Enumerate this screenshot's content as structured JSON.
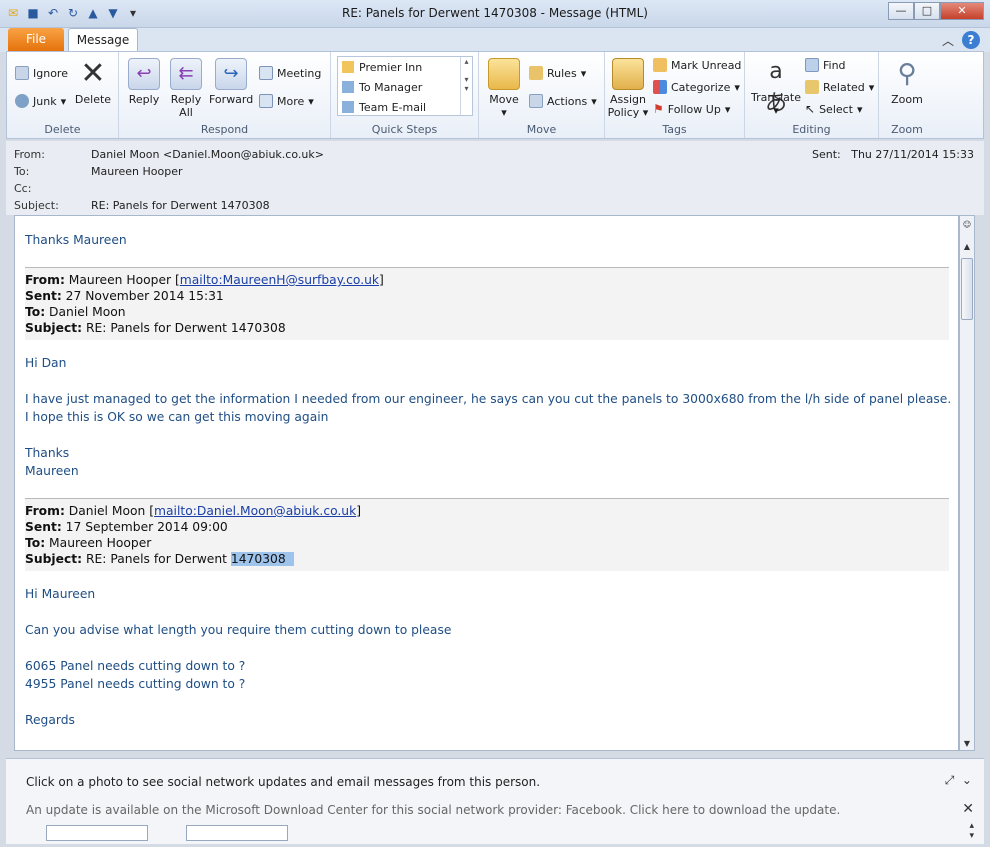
{
  "window": {
    "title": "RE: Panels for Derwent 1470308  -  Message (HTML)"
  },
  "tabs": {
    "file": "File",
    "message": "Message"
  },
  "ribbon": {
    "delete_group": {
      "label": "Delete",
      "ignore": "Ignore",
      "junk": "Junk",
      "delete": "Delete"
    },
    "respond_group": {
      "label": "Respond",
      "reply": "Reply",
      "reply_all_1": "Reply",
      "reply_all_2": "All",
      "forward": "Forward",
      "meeting": "Meeting",
      "more": "More"
    },
    "quicksteps_group": {
      "label": "Quick Steps",
      "items": [
        "Premier Inn",
        "To Manager",
        "Team E-mail"
      ]
    },
    "move_group": {
      "label": "Move",
      "move": "Move",
      "rules": "Rules",
      "actions": "Actions"
    },
    "tags_group": {
      "label": "Tags",
      "assign_1": "Assign",
      "assign_2": "Policy",
      "mark_unread": "Mark Unread",
      "categorize": "Categorize",
      "follow_up": "Follow Up"
    },
    "editing_group": {
      "label": "Editing",
      "translate": "Translate",
      "find": "Find",
      "related": "Related",
      "select": "Select"
    },
    "zoom_group": {
      "label": "Zoom",
      "zoom": "Zoom"
    }
  },
  "header": {
    "from_label": "From:",
    "from_value": "Daniel Moon <Daniel.Moon@abiuk.co.uk>",
    "to_label": "To:",
    "to_value": "Maureen Hooper",
    "cc_label": "Cc:",
    "subject_label": "Subject:",
    "subject_value": "RE: Panels for Derwent 1470308",
    "sent_label": "Sent:",
    "sent_value": "Thu 27/11/2014 15:33"
  },
  "message": {
    "greeting": "Thanks Maureen",
    "q1": {
      "from_label": "From:",
      "from_name": "Maureen Hooper [",
      "from_link": "mailto:MaureenH@surfbay.co.uk",
      "from_close": "]",
      "sent_label": "Sent:",
      "sent_value": "27 November 2014 15:31",
      "to_label": "To:",
      "to_value": "Daniel Moon",
      "subject_label": "Subject:",
      "subject_value": "RE: Panels for Derwent 1470308",
      "salutation": "Hi Dan",
      "line1": "I have just managed to get the information I needed from our engineer, he says can you cut the panels to 3000x680 from the l/h side of panel please.",
      "line2": "I hope this is OK so we can get this moving again",
      "sign1": "Thanks",
      "sign2": "Maureen"
    },
    "q2": {
      "from_label": "From:",
      "from_name": "Daniel Moon [",
      "from_link": "mailto:Daniel.Moon@abiuk.co.uk",
      "from_close": "]",
      "sent_label": "Sent:",
      "sent_value": "17 September 2014 09:00",
      "to_label": "To:",
      "to_value": "Maureen Hooper",
      "subject_label": "Subject:",
      "subject_prefix": "RE: Panels for Derwent ",
      "subject_selected": "1470308",
      "salutation": "Hi Maureen",
      "line1": "Can you advise what length you require them cutting down to please",
      "line2": "6065 Panel needs cutting down to ?",
      "line3": "4955 Panel needs cutting down to ?",
      "regards": "Regards"
    }
  },
  "social": {
    "prompt": "Click on a photo to see social network updates and email messages from this person.",
    "update": "An update is available on the Microsoft Download Center for this social network provider: Facebook. Click here to download the update."
  }
}
